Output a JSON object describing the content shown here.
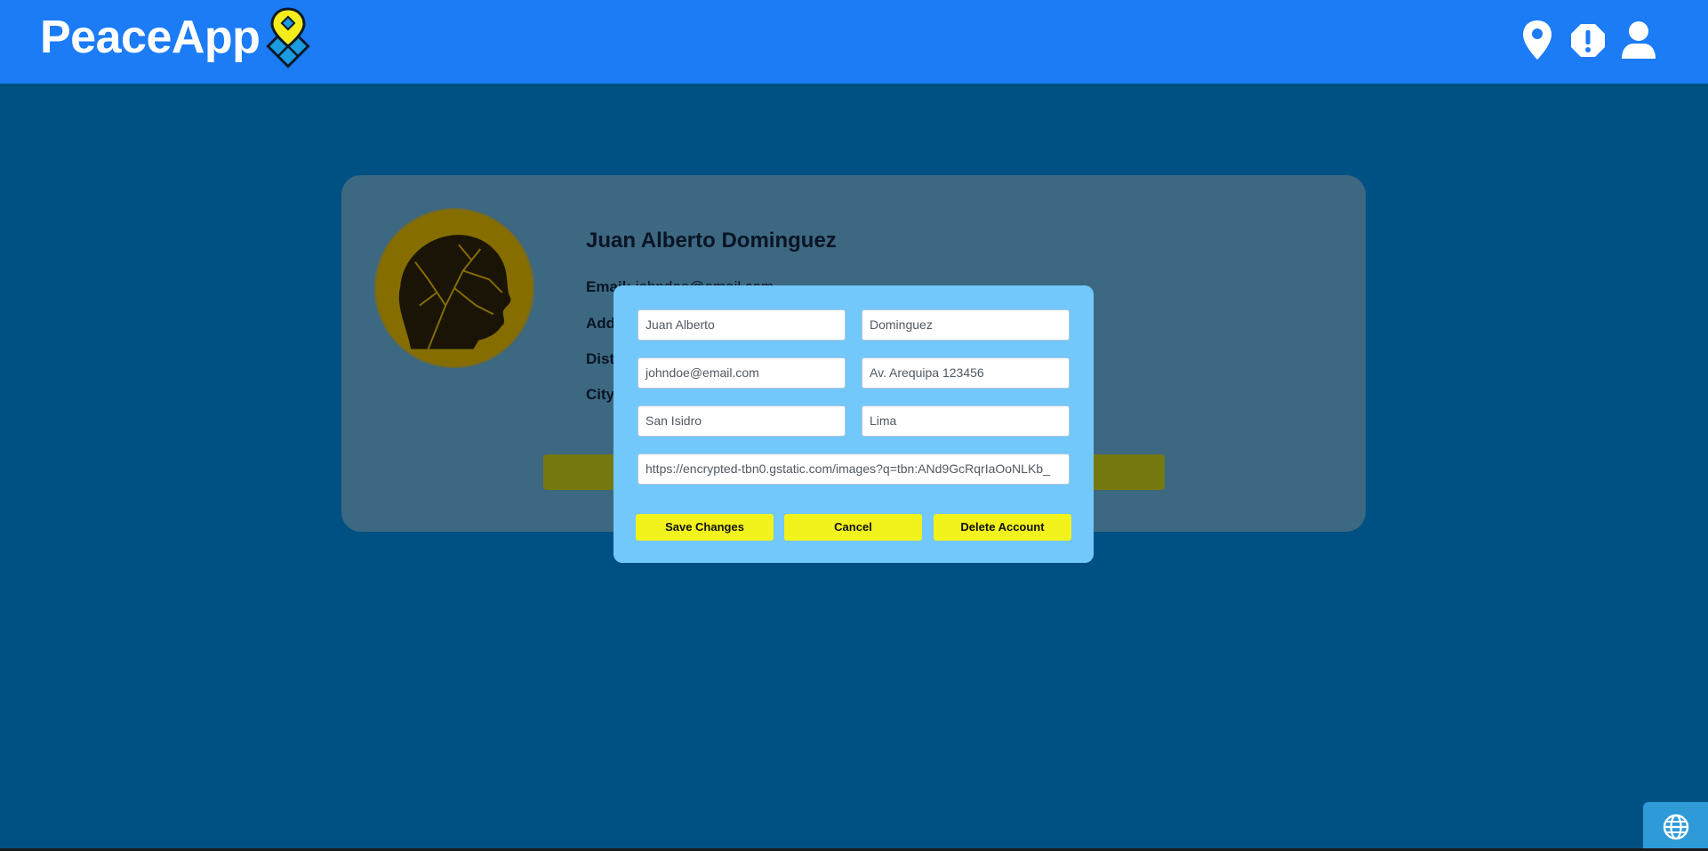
{
  "header": {
    "app_name": "PeaceApp",
    "logo_icon": "map-pin-logo-icon",
    "nav_icons": [
      "map-marker-icon",
      "alert-octagon-icon",
      "user-icon"
    ]
  },
  "profile": {
    "name": "Juan Alberto Dominguez",
    "email_label": "Email: ",
    "email_value": "johndoe@email.com",
    "address_label": "Address: ",
    "district_label": "District: ",
    "city_label": "City: "
  },
  "edit_form": {
    "first_name": "Juan Alberto",
    "last_name": "Dominguez",
    "email": "johndoe@email.com",
    "address": "Av. Arequipa 123456",
    "district": "San Isidro",
    "city": "Lima",
    "photo_url": "https://encrypted-tbn0.gstatic.com/images?q=tbn:ANd9GcRqrIaOoNLKb_",
    "save_label": "Save Changes",
    "cancel_label": "Cancel",
    "delete_label": "Delete Account"
  },
  "footer": {
    "language_icon": "globe-icon"
  },
  "colors": {
    "header_bg": "#1b7cf5",
    "page_bg": "#005183",
    "modal_bg": "#72c8fb",
    "button_yellow": "#f2f21c",
    "logo_yellow": "#f5ec1b"
  }
}
